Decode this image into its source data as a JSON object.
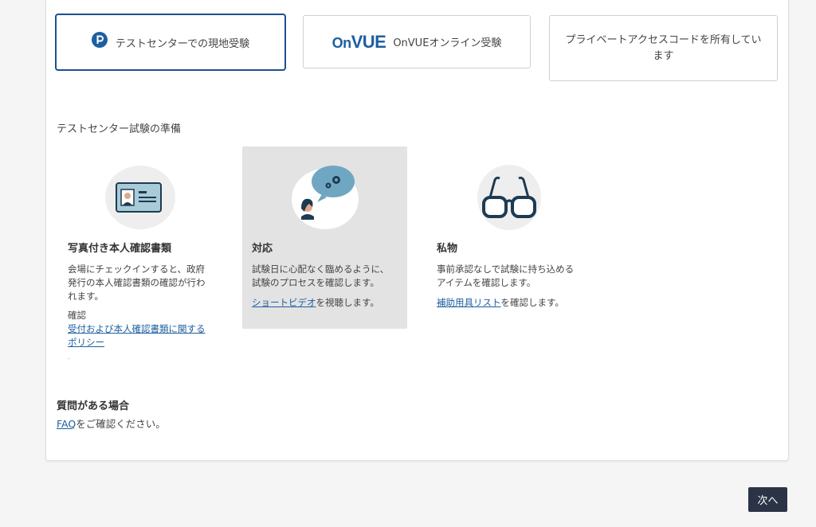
{
  "delivery_options": [
    {
      "label": "テストセンターでの現地受験",
      "icon": "pearson-logo-icon",
      "selected": true
    },
    {
      "logo_text_on": "On",
      "logo_text_vue": "VUE",
      "label": "OnVUEオンライン受験",
      "icon": "onvue-logo-icon",
      "selected": false
    },
    {
      "label": "プライベートアクセスコードを所有しています",
      "selected": false
    }
  ],
  "prep_section": {
    "title": "テストセンター試験の準備",
    "items": [
      {
        "icon": "id-card-icon",
        "title": "写真付き本人確認書類",
        "description": "会場にチェックインすると、政府発行の本人確認書類の確認が行われます。",
        "confirm_label": "確認",
        "link_text": "受付および本人確認書類に関するポリシー",
        "trailing": "."
      },
      {
        "icon": "speech-bubble-gears-icon",
        "title": "対応",
        "description": "試験日に心配なく臨めるように、試験のプロセスを確認します。",
        "link_text": "ショートビデオ",
        "link_suffix": "を視聴します。",
        "highlighted": true
      },
      {
        "icon": "glasses-icon",
        "title": "私物",
        "description": "事前承認なしで試験に持ち込めるアイテムを確認します。",
        "link_text": "補助用具リスト",
        "link_suffix": "を確認します。"
      }
    ]
  },
  "faq": {
    "title": "質問がある場合",
    "link_text": "FAQ",
    "suffix": "をご確認ください。"
  },
  "next_button": {
    "label": "次へ"
  },
  "colors": {
    "accent": "#1d4f91",
    "link": "#1d5fa0",
    "button_bg": "#2b3346",
    "highlight_bg": "#e3e3e3"
  }
}
